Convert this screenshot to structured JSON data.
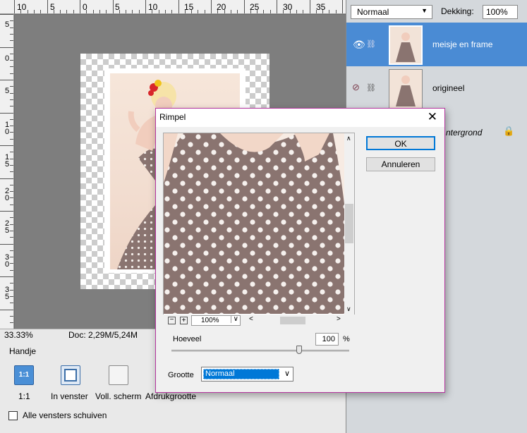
{
  "ruler": {
    "top_labels": [
      "10",
      "5",
      "0",
      "5",
      "10",
      "15",
      "20",
      "25",
      "30",
      "35"
    ],
    "left_labels": [
      "5",
      "0",
      "5",
      "1 0",
      "1 5",
      "2 0",
      "2 5",
      "3 0",
      "3 5"
    ]
  },
  "status": {
    "zoom": "33.33%",
    "doc": "Doc: 2,29M/5,24M"
  },
  "tool_options": {
    "tool_name": "Handje",
    "buttons": [
      {
        "icon": "1:1",
        "label": "1:1"
      },
      {
        "label": "In venster"
      },
      {
        "label": "Voll. scherm"
      },
      {
        "label": "Afdrukgrootte"
      }
    ],
    "checkbox_label": "Alle vensters schuiven",
    "checkbox_checked": false
  },
  "layers_panel": {
    "blend_mode": "Normaal",
    "opacity_label": "Dekking:",
    "opacity_value": "100%",
    "layers": [
      {
        "name": "meisje en frame",
        "visible": true,
        "selected": true
      },
      {
        "name": "origineel",
        "visible": false,
        "selected": false
      },
      {
        "name": "Achtergrond",
        "partial_visible": "ntergrond",
        "locked": true
      }
    ]
  },
  "dialog": {
    "title": "Rimpel",
    "ok_label": "OK",
    "cancel_label": "Annuleren",
    "preview_zoom": "100%",
    "amount_label": "Hoeveel",
    "amount_value": "100",
    "amount_unit": "%",
    "amount_level": 0.72,
    "size_label": "Grootte",
    "size_value": "Normaal"
  },
  "colors": {
    "accent": "#0078d7",
    "dialog_border": "#b4349e",
    "selected_layer": "#4a8bd4",
    "dress": "#8a7470"
  }
}
